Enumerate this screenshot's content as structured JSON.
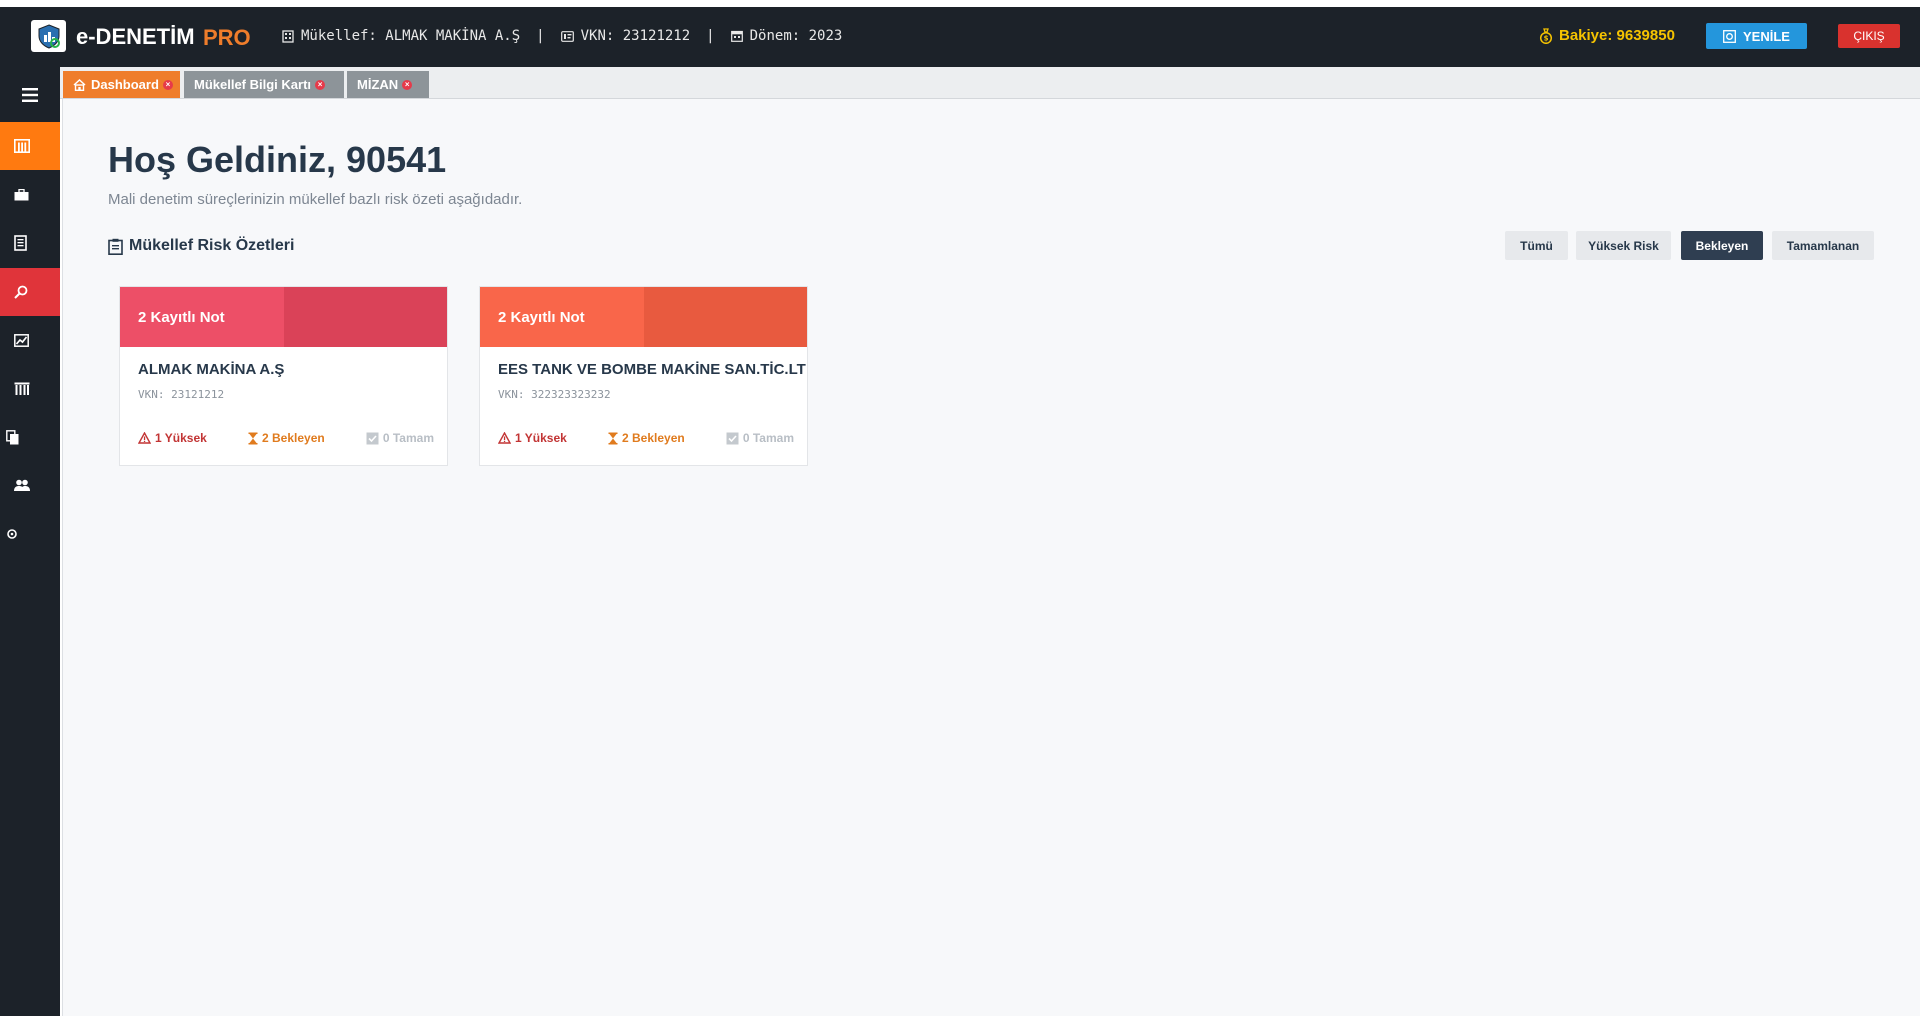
{
  "header": {
    "app_name": "e-DENETİM",
    "app_suffix": "PRO",
    "taxpayer": "Mükellef: ALMAK MAKİNA A.Ş",
    "vkn": "VKN: 23121212",
    "period": "Dönem: 2023",
    "separator": "|",
    "balance": "Bakiye: 9639850",
    "refresh_label": "YENİLE",
    "logout_label": "ÇIKIŞ",
    "colors": {
      "bar": "#1c2229",
      "accent": "#ef7d2b",
      "balance": "#f5c300",
      "refresh": "#2496dc",
      "logout": "#d9322e"
    }
  },
  "sidebar": {
    "items": [
      {
        "icon": "building-icon",
        "active": true,
        "color": "#ff7a10"
      },
      {
        "icon": "briefcase-icon",
        "active": false
      },
      {
        "icon": "document-icon",
        "active": false
      },
      {
        "icon": "search-icon",
        "active": true,
        "color": "#e0343a"
      },
      {
        "icon": "chart-icon",
        "active": false
      },
      {
        "icon": "bank-icon",
        "active": false
      },
      {
        "icon": "file-stack-icon",
        "active": false
      },
      {
        "icon": "users-icon",
        "active": false
      },
      {
        "icon": "gear-icon",
        "active": false
      }
    ]
  },
  "tabs": [
    {
      "label": "Dashboard",
      "icon": "home-icon",
      "active": true,
      "color": "#ef7d2b"
    },
    {
      "label": "Mükellef Bilgi Kartı",
      "active": false,
      "color": "#8d9499"
    },
    {
      "label": "MİZAN",
      "active": false,
      "color": "#8d9499"
    }
  ],
  "main": {
    "greeting": "Hoş Geldiniz, 90541",
    "subtitle": "Mali denetim süreçlerinizin mükellef bazlı risk özeti aşağıdadır.",
    "section_title": "Mükellef Risk Özetleri",
    "filters": [
      {
        "label": "Tümü",
        "active": false
      },
      {
        "label": "Yüksek Risk",
        "active": false
      },
      {
        "label": "Bekleyen",
        "active": true
      },
      {
        "label": "Tamamlanan",
        "active": false
      }
    ],
    "cards": [
      {
        "note_label": "2 Kayıtlı Not",
        "name": "ALMAK MAKİNA A.Ş",
        "vkn": "VKN: 23121212",
        "high": "1 Yüksek",
        "pending": "2 Bekleyen",
        "done": "0 Tamam",
        "head_colors": [
          "#ed4f67",
          "#da4258"
        ]
      },
      {
        "note_label": "2 Kayıtlı Not",
        "name": "EES TANK VE BOMBE MAKİNE SAN.TİC.LT",
        "vkn": "VKN: 322323323232",
        "high": "1 Yüksek",
        "pending": "2 Bekleyen",
        "done": "0 Tamam",
        "head_colors": [
          "#f9664a",
          "#e85a3f"
        ]
      }
    ]
  }
}
